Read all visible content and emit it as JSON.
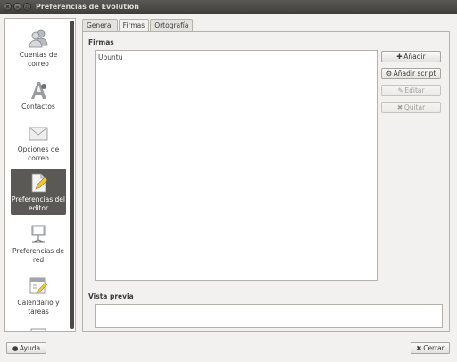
{
  "window": {
    "title": "Preferencias de Evolution"
  },
  "sidebar": {
    "items": [
      {
        "label": "Cuentas de correo",
        "icon": "accounts-icon"
      },
      {
        "label": "Contactos",
        "icon": "contacts-icon"
      },
      {
        "label": "Opciones de correo",
        "icon": "mail-icon"
      },
      {
        "label": "Preferencias del editor",
        "icon": "editor-icon",
        "selected": true
      },
      {
        "label": "Preferencias de red",
        "icon": "network-icon"
      },
      {
        "label": "Calendario y tareas",
        "icon": "calendar-icon"
      }
    ]
  },
  "tabs": [
    {
      "label": "General"
    },
    {
      "label": "Firmas",
      "active": true
    },
    {
      "label": "Ortografía"
    }
  ],
  "signatures": {
    "heading": "Firmas",
    "items": [
      "Ubuntu"
    ],
    "buttons": {
      "add": "Añadir",
      "add_script": "Añadir script",
      "edit": "Editar",
      "remove": "Quitar"
    }
  },
  "preview": {
    "heading": "Vista previa"
  },
  "footer": {
    "help": "Ayuda",
    "close": "Cerrar"
  },
  "colors": {
    "titlebar": "#3e3d39",
    "selected": "#5a5955",
    "accent": "#e07a2f"
  }
}
